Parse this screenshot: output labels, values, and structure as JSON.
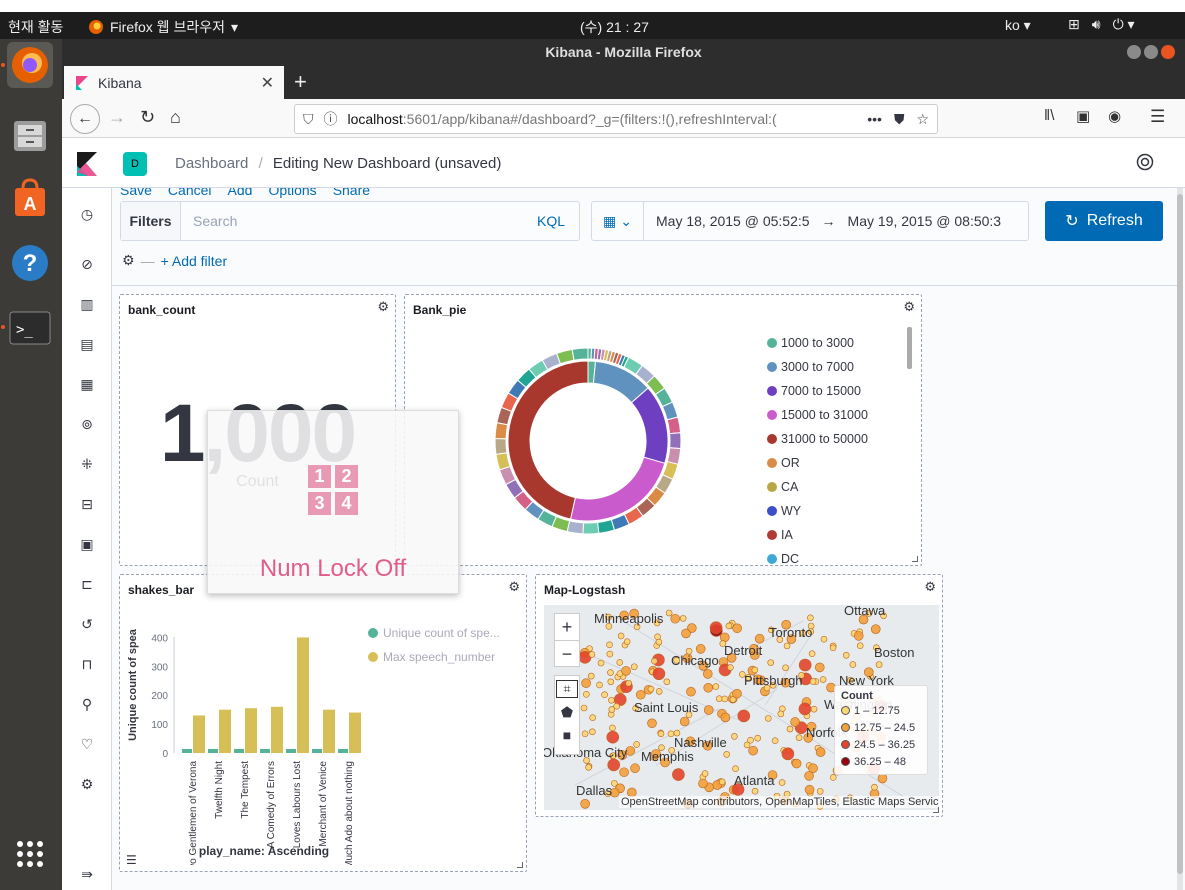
{
  "system": {
    "activities": "현재 활동",
    "app_name": "Firefox 웹 브라우저",
    "clock": "(수) 21 : 27",
    "lang": "ko"
  },
  "window": {
    "title": "Kibana - Mozilla Firefox",
    "tab_title": "Kibana",
    "url_host": "localhost",
    "url_rest": ":5601/app/kibana#/dashboard?_g=(filters:!(),refreshInterval:("
  },
  "kibana": {
    "space_initial": "D",
    "breadcrumbs": [
      "Dashboard",
      "Editing New Dashboard (unsaved)"
    ],
    "menu": [
      "Save",
      "Cancel",
      "Add",
      "Options",
      "Share"
    ],
    "filters_label": "Filters",
    "search_placeholder": "Search",
    "kql": "KQL",
    "date_start": "May 18, 2015 @ 05:52:5",
    "date_arrow": "→",
    "date_end": "May 19, 2015 @ 08:50:3",
    "refresh": "Refresh",
    "add_filter": "+ Add filter"
  },
  "panels": {
    "bank_count": {
      "title": "bank_count",
      "value": "1,000",
      "label": "Count"
    },
    "bank_pie": {
      "title": "Bank_pie",
      "legend": [
        {
          "label": "1000 to 3000",
          "color": "#54b399"
        },
        {
          "label": "3000 to 7000",
          "color": "#6092c0"
        },
        {
          "label": "7000 to 15000",
          "color": "#6f3fc2"
        },
        {
          "label": "15000 to 31000",
          "color": "#ca5bcc"
        },
        {
          "label": "31000 to 50000",
          "color": "#a8372e"
        },
        {
          "label": "OR",
          "color": "#da8b45"
        },
        {
          "label": "CA",
          "color": "#b9a647"
        },
        {
          "label": "WY",
          "color": "#3c4fc8"
        },
        {
          "label": "IA",
          "color": "#b23a36"
        },
        {
          "label": "DC",
          "color": "#3fa7d6"
        }
      ]
    },
    "shakes_bar": {
      "title": "shakes_bar",
      "ylabel": "Unique count of spea",
      "xlabel": "play_name: Ascending",
      "legend": [
        "Unique count of spe...",
        "Max speech_number"
      ],
      "colors": {
        "unique": "#54b399",
        "max": "#d6bf57"
      }
    },
    "map": {
      "title": "Map-Logstash",
      "legend_title": "Count",
      "legend": [
        {
          "label": "1 – 12.75",
          "color": "#fdd672"
        },
        {
          "label": "12.75 – 24.5",
          "color": "#f3a03b"
        },
        {
          "label": "24.5 – 36.25",
          "color": "#e3442b"
        },
        {
          "label": "36.25 – 48",
          "color": "#99000d"
        }
      ],
      "attribution": "OpenStreetMap contributors, OpenMapTiles, Elastic Maps Service",
      "places": [
        "Minneapolis",
        "Toronto",
        "Ottawa",
        "Chicago",
        "Detroit",
        "Boston",
        "Pittsburgh",
        "New York",
        "Washington",
        "Saint Louis",
        "Norfolk",
        "Nashville",
        "Memphis",
        "Oklahoma City",
        "Atlanta",
        "Dallas"
      ]
    }
  },
  "chart_data": {
    "type": "bar",
    "categories": [
      "Two Gentlemen of Verona",
      "Twelfth Night",
      "The Tempest",
      "A Comedy of Errors",
      "Loves Labours Lost",
      "Merchant of Venice",
      "Much Ado about nothing"
    ],
    "series": [
      {
        "name": "Unique count of spe...",
        "values": [
          14,
          14,
          14,
          14,
          14,
          14,
          14
        ]
      },
      {
        "name": "Max speech_number",
        "values": [
          130,
          150,
          155,
          160,
          400,
          150,
          140
        ]
      }
    ],
    "xlabel": "play_name: Ascending",
    "ylabel": "Unique count of spea",
    "yticks": [
      0,
      100,
      200,
      300,
      400
    ],
    "ylim": [
      0,
      450
    ]
  },
  "osd": {
    "keys": [
      "1",
      "2",
      "3",
      "4"
    ],
    "text": "Num Lock Off"
  }
}
